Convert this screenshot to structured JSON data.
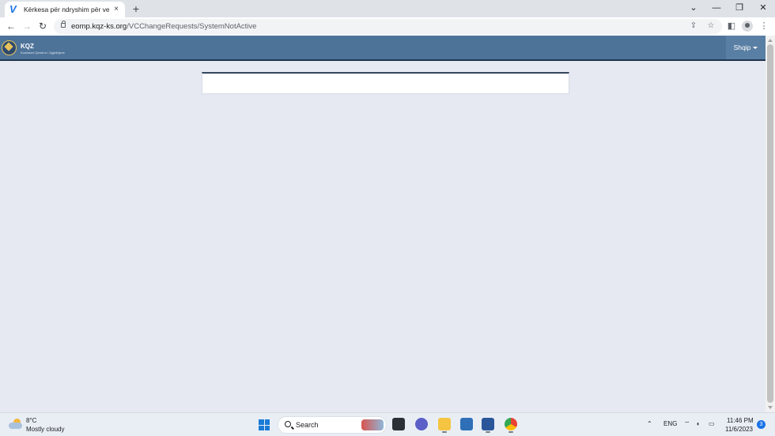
{
  "browser": {
    "tab_title": "Kërkesa për ndryshim për vendv",
    "tab_favicon": "V",
    "new_tab_symbol": "+",
    "close_tab_symbol": "×",
    "url_domain": "eomp.kqz-ks.org",
    "url_path": "/VCChangeRequests/SystemNotActive",
    "icons": [
      "back-icon",
      "forward-icon",
      "reload-icon",
      "lock-icon",
      "share-icon",
      "star-icon",
      "side-panel-icon",
      "profile-icon",
      "menu-icon"
    ]
  },
  "site": {
    "brand": "KQZ",
    "brand_subtitle": "Komisioni Qendror i Zgjedhjeve",
    "language": "Shqip",
    "header_color": "#4e7399",
    "page_background": "#e6e9f1"
  },
  "taskbar": {
    "temperature": "8°C",
    "weather": "Mostly cloudy",
    "search_label": "Search",
    "language_indicator": "ENG",
    "time": "11:46 PM",
    "date": "11/6/2023",
    "notification_count": "3",
    "apps": [
      "file-manager-icon",
      "meet-icon",
      "folder-icon",
      "photos-icon",
      "word-icon",
      "chrome-icon"
    ]
  }
}
